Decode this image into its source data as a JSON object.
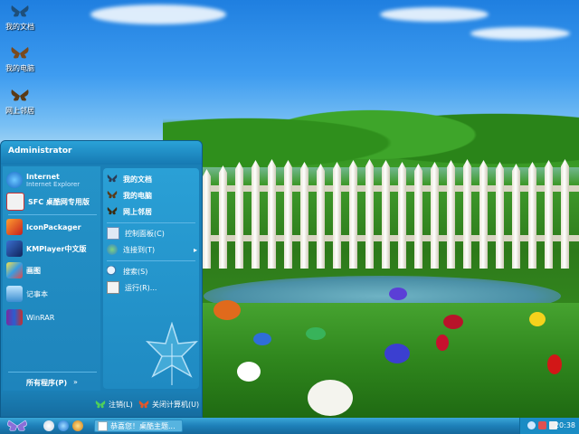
{
  "desktop": {
    "icons": [
      {
        "label": "我的文档"
      },
      {
        "label": "我的电脑"
      },
      {
        "label": "网上邻居"
      }
    ]
  },
  "start_menu": {
    "user": "Administrator",
    "pinned": [
      {
        "label": "Internet",
        "sub": "Internet Explorer"
      },
      {
        "label": "SFC 桌酷网专用版"
      }
    ],
    "recent": [
      {
        "label": "IconPackager"
      },
      {
        "label": "KMPlayer中文版"
      },
      {
        "label": "画图"
      },
      {
        "label": "记事本"
      },
      {
        "label": "WinRAR"
      }
    ],
    "all_programs": "所有程序(P)",
    "right": [
      {
        "label": "我的文档"
      },
      {
        "label": "我的电脑"
      },
      {
        "label": "网上邻居"
      },
      {
        "label": "控制面板(C)"
      },
      {
        "label": "连接到(T)"
      },
      {
        "label": "搜索(S)"
      },
      {
        "label": "运行(R)..."
      }
    ],
    "logoff": "注销(L)",
    "shutdown": "关闭计算机(U)"
  },
  "taskbar": {
    "task_label": "恭喜您！桌酷主题...",
    "clock": "20:38"
  },
  "colors": {
    "start_menu_bg": "#1a7fb6",
    "taskbar": "#1d7fb8",
    "accent": "#2aa0d6"
  }
}
